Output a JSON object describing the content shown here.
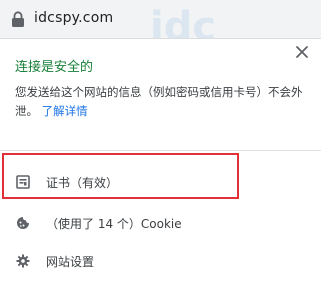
{
  "addressbar": {
    "url": "idcspy.com",
    "lock_icon": "lock-icon"
  },
  "popup": {
    "title": "连接是安全的",
    "description": "您发送给这个网站的信息（例如密码或信用卡号）不会外泄。",
    "learn_more": "了解详情",
    "items": [
      {
        "label": "证书（有效）",
        "icon": "certificate-icon"
      },
      {
        "label": "（使用了 14 个）Cookie",
        "icon": "cookie-icon"
      },
      {
        "label": "网站设置",
        "icon": "gear-icon"
      }
    ]
  },
  "colors": {
    "secure_green": "#188038",
    "link_blue": "#1a73e8",
    "highlight_red": "#e0303a"
  }
}
